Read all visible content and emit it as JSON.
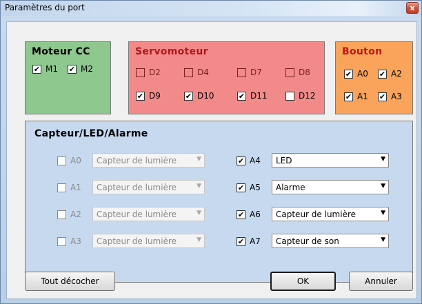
{
  "window": {
    "title": "Paramètres du port",
    "close_glyph": "x"
  },
  "moteur": {
    "title": "Moteur CC",
    "items": [
      {
        "label": "M1",
        "checked": true
      },
      {
        "label": "M2",
        "checked": true
      }
    ]
  },
  "servo": {
    "title": "Servomoteur",
    "items": [
      {
        "label": "D2",
        "checked": false
      },
      {
        "label": "D4",
        "checked": false
      },
      {
        "label": "D7",
        "checked": false
      },
      {
        "label": "D8",
        "checked": false
      },
      {
        "label": "D9",
        "checked": true
      },
      {
        "label": "D10",
        "checked": true
      },
      {
        "label": "D11",
        "checked": true
      },
      {
        "label": "D12",
        "checked": false
      }
    ]
  },
  "bouton": {
    "title": "Bouton",
    "items": [
      {
        "label": "A0",
        "checked": true
      },
      {
        "label": "A2",
        "checked": true
      },
      {
        "label": "A1",
        "checked": true
      },
      {
        "label": "A3",
        "checked": true
      }
    ]
  },
  "capteur": {
    "title": "Capteur/LED/Alarme",
    "left": [
      {
        "label": "A0",
        "checked": false,
        "value": "Capteur de lumière",
        "enabled": false
      },
      {
        "label": "A1",
        "checked": false,
        "value": "Capteur de lumière",
        "enabled": false
      },
      {
        "label": "A2",
        "checked": false,
        "value": "Capteur de lumière",
        "enabled": false
      },
      {
        "label": "A3",
        "checked": false,
        "value": "Capteur de lumière",
        "enabled": false
      }
    ],
    "right": [
      {
        "label": "A4",
        "checked": true,
        "value": "LED",
        "enabled": true
      },
      {
        "label": "A5",
        "checked": true,
        "value": "Alarme",
        "enabled": true
      },
      {
        "label": "A6",
        "checked": true,
        "value": "Capteur de lumière",
        "enabled": true
      },
      {
        "label": "A7",
        "checked": true,
        "value": "Capteur de son",
        "enabled": true
      }
    ]
  },
  "buttons": {
    "clear_all": "Tout décocher",
    "ok": "OK",
    "cancel": "Annuler"
  },
  "glyphs": {
    "check": "✔",
    "dropdown": "▼"
  }
}
